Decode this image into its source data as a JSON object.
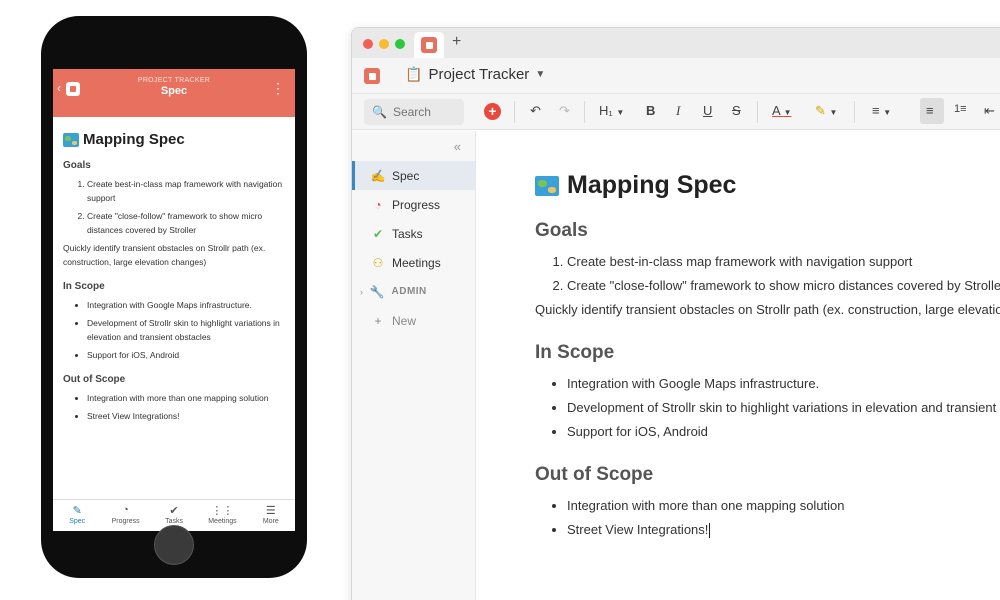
{
  "phone": {
    "header": {
      "project": "PROJECT TRACKER",
      "page": "Spec"
    },
    "doc": {
      "title": "Mapping Spec",
      "goals_heading": "Goals",
      "goals": [
        "Create best-in-class map framework with navigation support",
        "Create \"close-follow\" framework to show micro distances covered by Stroller"
      ],
      "goals_note": "Quickly identify transient obstacles on Strollr path (ex. construction, large elevation changes)",
      "in_scope_heading": "In Scope",
      "in_scope": [
        "Integration with Google Maps infrastructure.",
        "Development of Strollr skin to highlight variations in elevation and transient obstacles",
        "Support for iOS, Android"
      ],
      "out_scope_heading": "Out of Scope",
      "out_scope": [
        "Integration with more than one mapping solution",
        "Street View Integrations!"
      ]
    },
    "tabs": [
      {
        "label": "Spec",
        "icon": "pen-icon",
        "active": true
      },
      {
        "label": "Progress",
        "icon": "pie-chart-icon"
      },
      {
        "label": "Tasks",
        "icon": "check-circle-icon"
      },
      {
        "label": "Meetings",
        "icon": "people-icon"
      },
      {
        "label": "More",
        "icon": "menu-icon"
      }
    ]
  },
  "desktop": {
    "doc_title": "Project Tracker",
    "search": {
      "placeholder": "Search"
    },
    "toolbar": {
      "heading": "H₁"
    },
    "sidebar": {
      "items": [
        {
          "label": "Spec",
          "icon": "pen-icon",
          "active": true
        },
        {
          "label": "Progress",
          "icon": "pie-chart-icon"
        },
        {
          "label": "Tasks",
          "icon": "check-circle-icon"
        },
        {
          "label": "Meetings",
          "icon": "people-icon"
        }
      ],
      "admin": "ADMIN",
      "new": "New"
    },
    "doc": {
      "title": "Mapping Spec",
      "goals_heading": "Goals",
      "goals": [
        "Create best-in-class map framework with navigation support",
        "Create \"close-follow\" framework to show micro distances covered by Stroller"
      ],
      "goals_note": "Quickly identify transient obstacles on Strollr path (ex. construction, large elevation changes)",
      "in_scope_heading": "In Scope",
      "in_scope": [
        "Integration with Google Maps infrastructure.",
        "Development of Strollr skin to highlight variations in elevation and transient obstacles",
        "Support for iOS, Android"
      ],
      "out_scope_heading": "Out of Scope",
      "out_scope": [
        "Integration with more than one mapping solution",
        "Street View Integrations!"
      ]
    }
  },
  "colors": {
    "accent": "#e8705f",
    "active_tab": "#1f7ea6",
    "add_button": "#e8493c",
    "sidebar_active": "#3d86c6"
  }
}
